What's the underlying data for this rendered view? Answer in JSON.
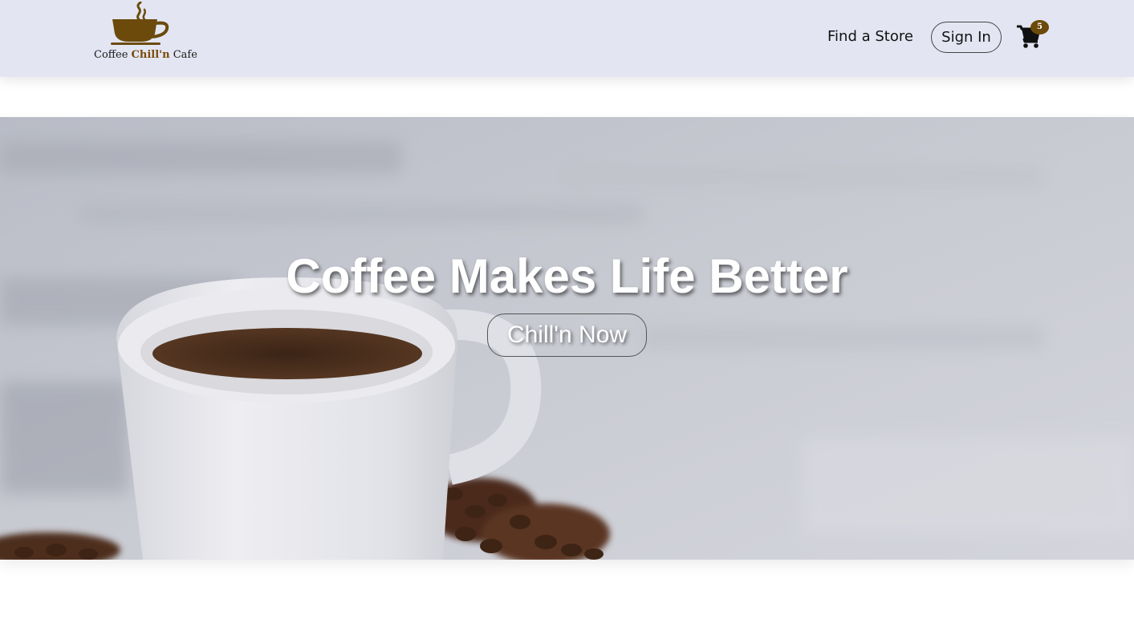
{
  "brand": {
    "logo_icon": "coffee-cup-icon",
    "name_prefix": "Coffee ",
    "name_accent": "Chill'n",
    "name_suffix": " Cafe",
    "accent_color": "#7a4a0a"
  },
  "nav": {
    "find_store": "Find a Store",
    "sign_in": "Sign In",
    "cart_icon": "shopping-cart-icon",
    "cart_count": "5"
  },
  "hero": {
    "title": "Coffee Makes Life Better",
    "cta": "Chill'n Now",
    "image_icon": "coffee-mug-photo"
  },
  "colors": {
    "navbar_bg": "#e3e6f2",
    "badge_bg": "#6b4a0c"
  }
}
